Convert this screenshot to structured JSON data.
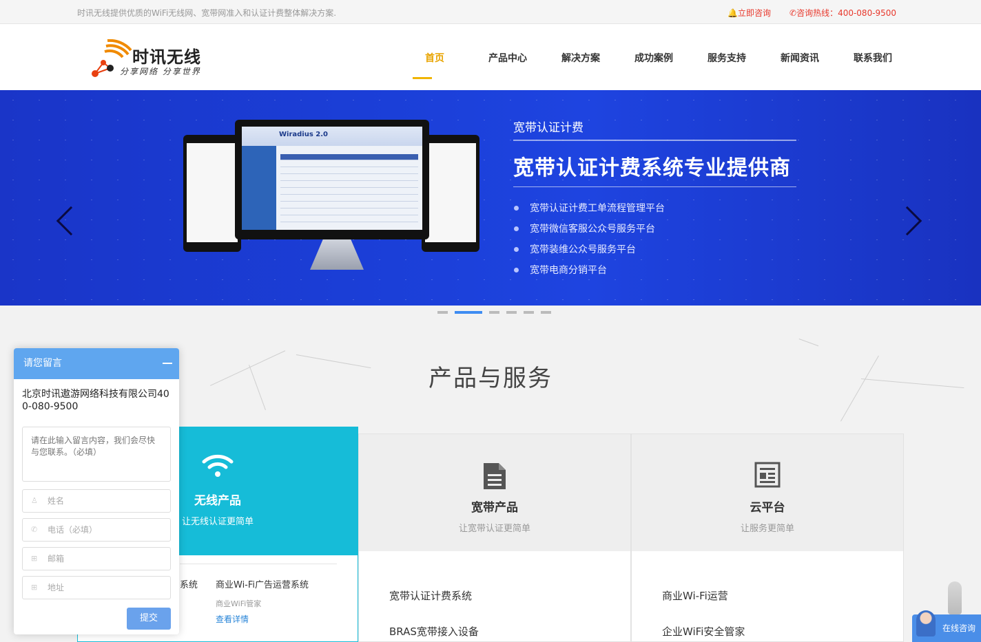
{
  "topbar": {
    "slogan": "时讯无线提供优质的WiFi无线网、宽带网准入和认证计费整体解决方案.",
    "consult": "立即咨询",
    "hotline": "咨询热线：400-080-9500"
  },
  "logo": {
    "brand": "时讯无线",
    "tagline": "分享网络 分享世界"
  },
  "nav": [
    {
      "label": "首页",
      "active": true
    },
    {
      "label": "产品中心"
    },
    {
      "label": "解决方案"
    },
    {
      "label": "成功案例"
    },
    {
      "label": "服务支持"
    },
    {
      "label": "新闻资讯"
    },
    {
      "label": "联系我们"
    }
  ],
  "banner": {
    "subtitle": "宽带认证计费",
    "title": "宽带认证计费系统专业提供商",
    "points": [
      "宽带认证计费工单流程管理平台",
      "宽带微信客服公众号服务平台",
      "宽带装维公众号服务平台",
      "宽带电商分销平台"
    ],
    "screen_title": "Wiradius 2.0",
    "slide_count": 6,
    "active_slide": 2
  },
  "section": {
    "title": "产品与服务"
  },
  "cards": {
    "wireless": {
      "title": "无线产品",
      "subtitle": "让无线认证更简单",
      "item_cut": "系统",
      "item": "商业Wi-Fi广告运营系统",
      "item_sub": "商业WiFi管家",
      "item_link": "查看详情"
    },
    "broadband": {
      "title": "宽带产品",
      "subtitle": "让宽带认证更简单",
      "items": [
        "宽带认证计费系统",
        "BRAS宽带接入设备"
      ]
    },
    "cloud": {
      "title": "云平台",
      "subtitle": "让服务更简单",
      "items": [
        "商业Wi-Fi运营",
        "企业WiFi安全管家"
      ]
    }
  },
  "message": {
    "header": "请您留言",
    "company": "北京时讯遨游网络科技有限公司400-080-9500",
    "content_placeholder": "请在此输入留言内容，我们会尽快与您联系。（必填）",
    "name_placeholder": "姓名",
    "phone_placeholder": "电话（必填）",
    "email_placeholder": "邮箱",
    "address_placeholder": "地址",
    "submit": "提交"
  },
  "online": {
    "label": "在线咨询"
  },
  "colors": {
    "accent": "#e8a400",
    "banner": "#1b3fd8",
    "cyan": "#16bcd8",
    "panel": "#5fa6ef"
  }
}
